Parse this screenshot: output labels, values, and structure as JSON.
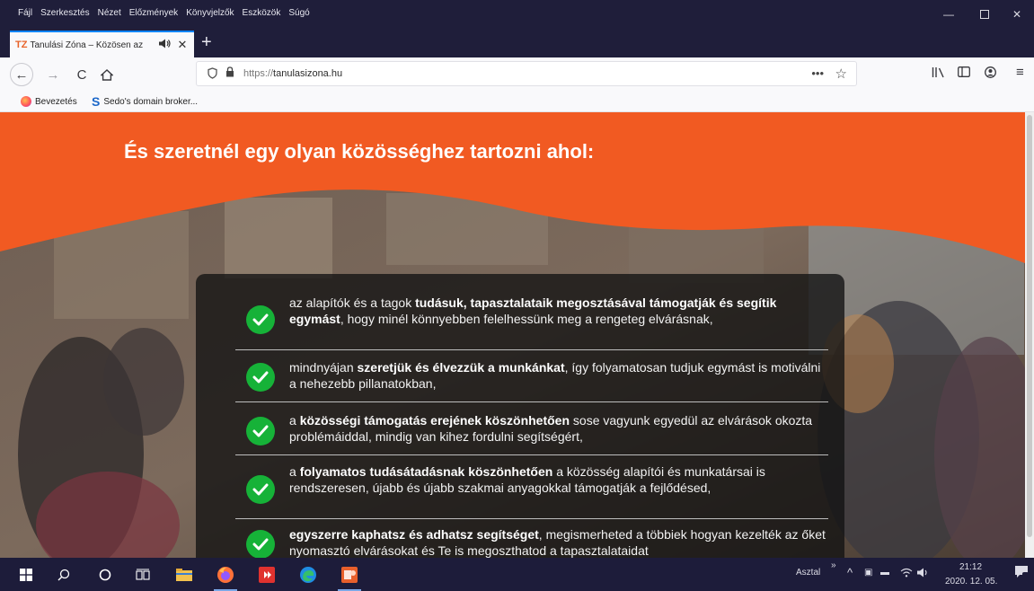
{
  "menubar": {
    "menus": [
      "Fájl",
      "Szerkesztés",
      "Nézet",
      "Előzmények",
      "Könyvjelzők",
      "Eszközök",
      "Súgó"
    ]
  },
  "tab": {
    "favicon_text": "TZ",
    "title": "Tanulási Zóna – Közösen az",
    "close": "✕"
  },
  "navbar": {
    "url_protocol": "https://",
    "url_domain": "tanulasizona.hu",
    "more": "•••"
  },
  "bookmarks": [
    {
      "label": "Bevezetés"
    },
    {
      "label": "Sedo's domain broker..."
    }
  ],
  "page": {
    "title": "És szeretnél egy olyan közösséghez tartozni ahol:",
    "items": [
      {
        "pre": "az alapítók és a tagok ",
        "bold": "tudásuk, tapasztalataik megosztásával támogatják és segítik egymást",
        "post": ", hogy minél könnyebben felelhessünk meg a rengeteg elvárásnak,"
      },
      {
        "pre": "mindnyájan ",
        "bold": "szeretjük és élvezzük a munkánkat",
        "post": ", így folyamatosan tudjuk egymást is motiválni a nehezebb pillanatokban,"
      },
      {
        "pre": "a ",
        "bold": "közösségi támogatás erejének köszönhetően",
        "post": " sose vagyunk egyedül az elvárások okozta problémáiddal, mindig van kihez fordulni segítségért,"
      },
      {
        "pre": "a ",
        "bold": "folyamatos tudásátadásnak köszönhetően",
        "post": " a közösség alapítói és munkatársai is rendszeresen, újabb és újabb szakmai anyagokkal támogatják a fejlődésed,"
      },
      {
        "pre": "",
        "bold": "egyszerre kaphatsz és adhatsz segítséget",
        "post": ", megismerheted a többiek hogyan kezelték az őket nyomasztó elvárásokat és Te is megoszthatod a tapasztalataidat"
      }
    ]
  },
  "taskbar": {
    "desktop_label": "Asztal",
    "chevron": "»",
    "time": "21:12",
    "date": "2020. 12. 05."
  },
  "colors": {
    "accent_orange": "#f15a22",
    "check_green": "#16b238",
    "chrome_dark": "#1f1e3a"
  }
}
